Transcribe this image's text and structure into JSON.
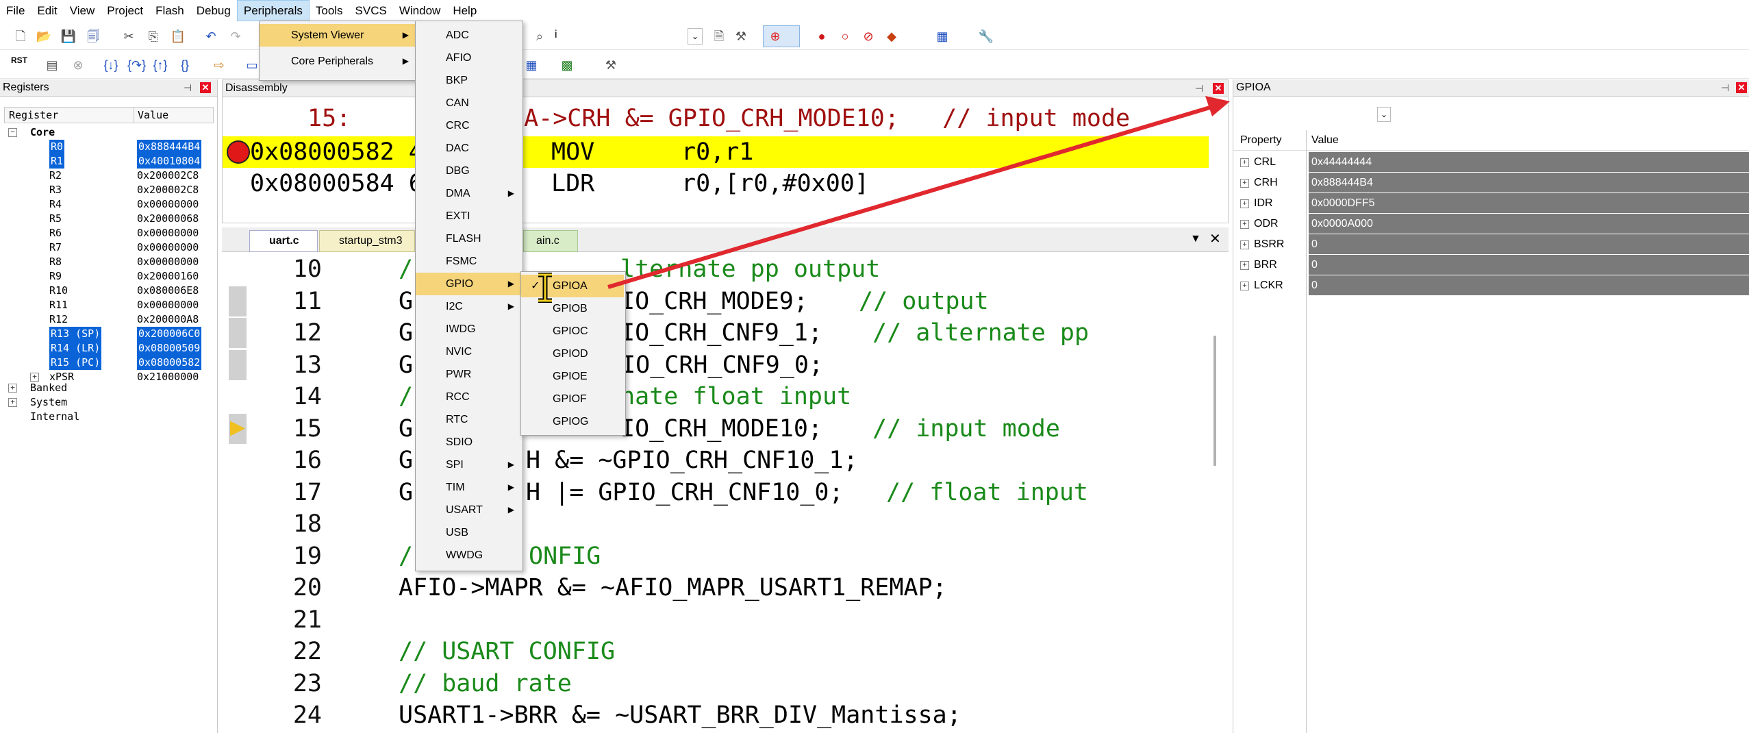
{
  "menubar": [
    "File",
    "Edit",
    "View",
    "Project",
    "Flash",
    "Debug",
    "Peripherals",
    "Tools",
    "SVCS",
    "Window",
    "Help"
  ],
  "peripherals_menu": {
    "items": [
      "System Viewer",
      "Core Peripherals"
    ]
  },
  "sysviewer_menu": [
    "ADC",
    "AFIO",
    "BKP",
    "CAN",
    "CRC",
    "DAC",
    "DBG",
    "DMA",
    "EXTI",
    "FLASH",
    "FSMC",
    "GPIO",
    "I2C",
    "IWDG",
    "NVIC",
    "PWR",
    "RCC",
    "RTC",
    "SDIO",
    "SPI",
    "TIM",
    "USART",
    "USB",
    "WWDG"
  ],
  "gpio_menu": [
    "GPIOA",
    "GPIOB",
    "GPIOC",
    "GPIOD",
    "GPIOE",
    "GPIOF",
    "GPIOG"
  ],
  "toolbar": {
    "rst_label": "RST",
    "field_text": "i"
  },
  "registers": {
    "title": "Registers",
    "col_register": "Register",
    "col_value": "Value",
    "group_core": "Core",
    "rows": [
      {
        "name": "R0",
        "value": "0x888444B4",
        "sel": true
      },
      {
        "name": "R1",
        "value": "0x40010804",
        "sel": true
      },
      {
        "name": "R2",
        "value": "0x200002C8",
        "sel": false
      },
      {
        "name": "R3",
        "value": "0x200002C8",
        "sel": false
      },
      {
        "name": "R4",
        "value": "0x00000000",
        "sel": false
      },
      {
        "name": "R5",
        "value": "0x20000068",
        "sel": false
      },
      {
        "name": "R6",
        "value": "0x00000000",
        "sel": false
      },
      {
        "name": "R7",
        "value": "0x00000000",
        "sel": false
      },
      {
        "name": "R8",
        "value": "0x00000000",
        "sel": false
      },
      {
        "name": "R9",
        "value": "0x20000160",
        "sel": false
      },
      {
        "name": "R10",
        "value": "0x080006E8",
        "sel": false
      },
      {
        "name": "R11",
        "value": "0x00000000",
        "sel": false
      },
      {
        "name": "R12",
        "value": "0x200000A8",
        "sel": false
      },
      {
        "name": "R13 (SP)",
        "value": "0x200006C0",
        "sel": true
      },
      {
        "name": "R14 (LR)",
        "value": "0x08000509",
        "sel": true
      },
      {
        "name": "R15 (PC)",
        "value": "0x08000582",
        "sel": true
      },
      {
        "name": "xPSR",
        "value": "0x21000000",
        "sel": false
      }
    ],
    "groups_after": [
      "Banked",
      "System",
      "Internal"
    ]
  },
  "disassembly": {
    "title": "Disassembly",
    "source_line": "15:        GPIOA->CRH &= GPIO_CRH_MODE10;   // input mode",
    "rows": [
      {
        "addr": "0x08000582 4",
        "op": "MOV",
        "args": "r0,r1"
      },
      {
        "addr": "0x08000584 6",
        "op": "LDR",
        "args": "r0,[r0,#0x00]"
      }
    ]
  },
  "tabs": [
    "uart.c",
    "startup_stm3",
    "ain.c"
  ],
  "code": [
    {
      "n": "10",
      "text": "/ ",
      "comment": "alternate pp output",
      "pre": "// "
    },
    {
      "n": "11",
      "text": "G",
      "comment": "// output"
    },
    {
      "n": "12",
      "text": "G",
      "comment": "// alternate pp"
    },
    {
      "n": "13",
      "text": "G"
    },
    {
      "n": "14",
      "text": "/"
    },
    {
      "n": "15",
      "text": "G",
      "comment": "// input mode"
    },
    {
      "n": "16",
      "text": "G"
    },
    {
      "n": "17",
      "text": "G",
      "comment": "// float input"
    },
    {
      "n": "18",
      "text": ""
    },
    {
      "n": "19",
      "text": "/"
    },
    {
      "n": "20",
      "text": "AFIO->MAPR &= ~AFIO_MAPR_USART1_REMAP;"
    },
    {
      "n": "21",
      "text": ""
    },
    {
      "n": "22",
      "text": "",
      "comment": "// USART CONFIG"
    },
    {
      "n": "23",
      "text": "",
      "comment": "// baud rate"
    },
    {
      "n": "24",
      "text": "USART1->BRR &= ~USART_BRR_DIV_Mantissa;"
    }
  ],
  "code_fragments": {
    "l10": "lternate pp output",
    "l11a": "IO_CRH_MODE9;",
    "l11c": "// output",
    "l12a": "IO_CRH_CNF9_1;",
    "l12c": "// alternate pp",
    "l13a": "PIO_CRH_CNF9_0;",
    "l14a": "nate float input",
    "l15a": "IO_CRH_MODE10;",
    "l15c": "// input mode",
    "l16a": "H &= ~GPIO_CRH_CNF10_1;",
    "l17a": "H |= GPIO_CRH_CNF10_0;",
    "l17c": "// float input",
    "l19a": "ONFIG"
  },
  "gpioa": {
    "title": "GPIOA",
    "col_property": "Property",
    "col_value": "Value",
    "rows": [
      {
        "name": "CRL",
        "value": "0x44444444"
      },
      {
        "name": "CRH",
        "value": "0x888444B4"
      },
      {
        "name": "IDR",
        "value": "0x0000DFF5"
      },
      {
        "name": "ODR",
        "value": "0x0000A000"
      },
      {
        "name": "BSRR",
        "value": "0"
      },
      {
        "name": "BRR",
        "value": "0"
      },
      {
        "name": "LCKR",
        "value": "0"
      }
    ]
  },
  "colors": {
    "accent": "#0a64d8",
    "highlight": "#ffff00",
    "arrow": "#e0282e",
    "menu_hl": "#f5d47a"
  }
}
